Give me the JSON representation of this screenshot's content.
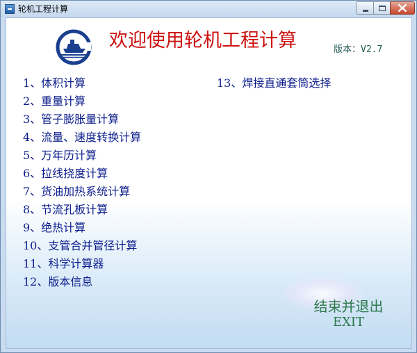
{
  "window": {
    "title": "轮机工程计算"
  },
  "header": {
    "title": "欢迎使用轮机工程计算",
    "version": "版本：V2.7"
  },
  "menu": {
    "items": [
      {
        "label": "1、体积计算"
      },
      {
        "label": "2、重量计算"
      },
      {
        "label": "3、管子膨胀量计算"
      },
      {
        "label": "4、流量、速度转换计算"
      },
      {
        "label": "5、万年历计算"
      },
      {
        "label": "6、拉线挠度计算"
      },
      {
        "label": "7、货油加热系统计算"
      },
      {
        "label": "8、节流孔板计算"
      },
      {
        "label": "9、绝热计算"
      },
      {
        "label": "10、支管合并管径计算"
      },
      {
        "label": "11、科学计算器"
      },
      {
        "label": "12、版本信息"
      },
      {
        "label": "13、焊接直通套筒选择"
      }
    ]
  },
  "exit": {
    "label_cn": "结束并退出",
    "label_en": "EXIT"
  },
  "colors": {
    "title": "#cc1111",
    "menu_text": "#0b1c8c",
    "exit_text": "#2f7a4e",
    "version_text": "#1f5a52",
    "logo_blue": "#1a3f8f"
  },
  "icons": {
    "app": "app-icon",
    "logo": "ship-logo-icon",
    "minimize": "minimize-icon",
    "maximize": "maximize-icon",
    "close": "close-icon"
  }
}
